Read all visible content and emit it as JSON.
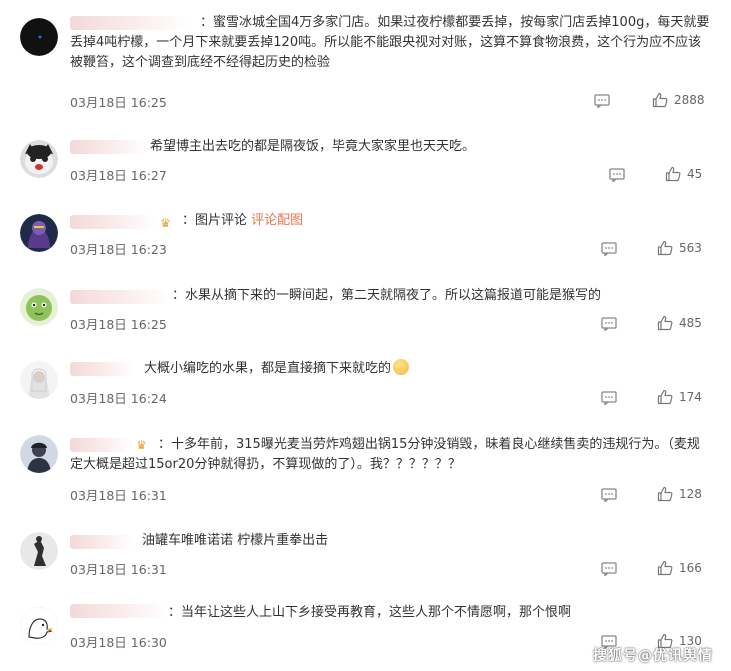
{
  "comments": [
    {
      "text": "：蜜雪冰城全国4万多家门店。如果过夜柠檬都要丢掉，按每家门店丢掉100g，每天就要丢掉4吨柠檬，一个月下来就要丢掉120吨。所以能不能跟央视对对账，这算不算食物浪费，这个行为应不应该被鞭笞，这个调查到底经不经得起历史的检验",
      "time": "03月18日 16:25",
      "likes": "2888"
    },
    {
      "text": "希望博主出去吃的都是隔夜饭，毕竟大家家里也天天吃。",
      "time": "03月18日 16:27",
      "likes": "45"
    },
    {
      "text": "：图片评论",
      "link": "评论配图",
      "time": "03月18日 16:23",
      "likes": "563"
    },
    {
      "text": "：水果从摘下来的一瞬间起，第二天就隔夜了。所以这篇报道可能是猴写的",
      "time": "03月18日 16:25",
      "likes": "485"
    },
    {
      "text": "大概小编吃的水果，都是直接摘下来就吃的",
      "time": "03月18日 16:24",
      "likes": "174"
    },
    {
      "text": "：十多年前，315曝光麦当劳炸鸡翅出锅15分钟没销毁，昧着良心继续售卖的违规行为。（麦规定大概是超过15or20分钟就得扔，不算现做的了）。我？？？？？？",
      "time": "03月18日 16:31",
      "likes": "128"
    },
    {
      "text": "油罐车唯唯诺诺 柠檬片重拳出击",
      "time": "03月18日 16:31",
      "likes": "166"
    },
    {
      "text": "：当年让这些人上山下乡接受再教育，这些人那个不情愿啊，那个恨啊",
      "time": "03月18日 16:30",
      "likes": "130"
    }
  ],
  "watermark": "搜狐号@优讯舆情",
  "colors": {
    "link": "#eb7350",
    "text": "#333333",
    "meta": "#666666",
    "crown": "#e8a33a"
  }
}
